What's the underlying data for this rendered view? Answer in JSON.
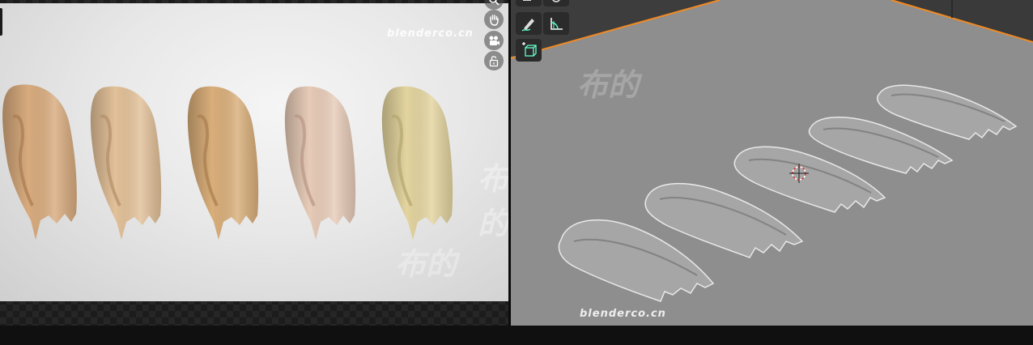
{
  "render_view": {
    "watermark_url": "blenderco.cn",
    "watermark_cn": "布的",
    "nav_icons": [
      "zoom-icon",
      "hand-pan-icon",
      "camera-icon",
      "lock-icon"
    ]
  },
  "viewport_3d": {
    "watermark_url": "blenderco.cn",
    "watermark_cn": "布的",
    "tool_icons": [
      "annotate-icon",
      "measure-icon",
      "add-cube-icon"
    ]
  },
  "colors": {
    "swatch_1": "#d8ab7e",
    "swatch_2": "#e2c199",
    "swatch_3": "#d9ae7a",
    "swatch_4": "#e7cbb8",
    "swatch_5": "#e3d49f",
    "viewport_bg": "#8f8f8f",
    "selection_orange": "#f08a24",
    "ui_dark": "#2b2b2b"
  }
}
